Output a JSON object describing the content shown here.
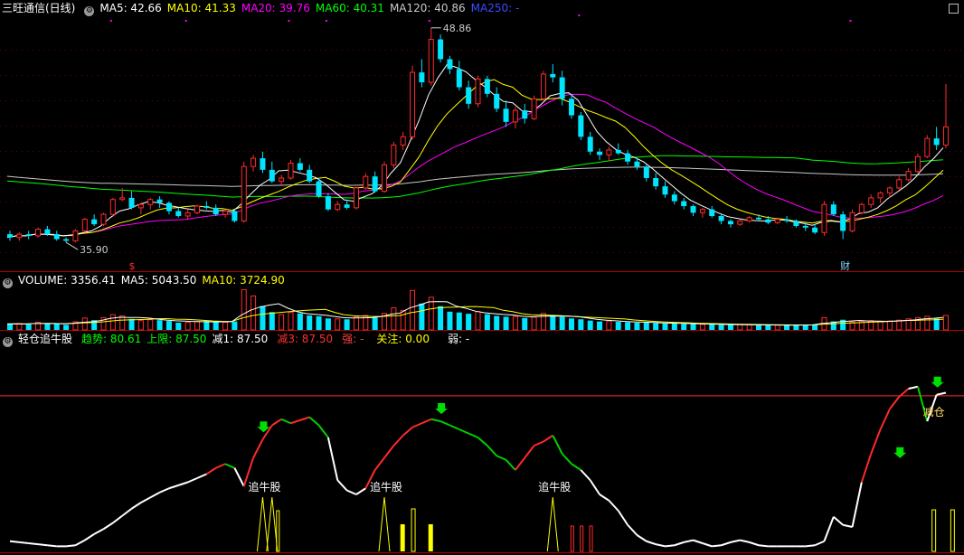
{
  "price_panel": {
    "stock_name": "三旺通信(日线)",
    "ma": [
      {
        "label": "MA5: 42.66",
        "color": "#ffffff"
      },
      {
        "label": "MA10: 41.33",
        "color": "#ffff00"
      },
      {
        "label": "MA20: 39.76",
        "color": "#ff00ff"
      },
      {
        "label": "MA60: 40.31",
        "color": "#00ff00"
      },
      {
        "label": "MA120: 40.86",
        "color": "#c8c8c8"
      },
      {
        "label": "MA250: -",
        "color": "#3a4cff"
      }
    ],
    "high_label": "48.86",
    "low_label": "35.90",
    "marker_dollar": "$",
    "marker_cai": "财"
  },
  "volume_panel": {
    "items": [
      {
        "label": "VOLUME: 3356.41",
        "color": "#ffffff"
      },
      {
        "label": "MA5: 5043.50",
        "color": "#ffffff"
      },
      {
        "label": "MA10: 3724.90",
        "color": "#ffff00"
      }
    ]
  },
  "indicator_panel": {
    "name": "轻仓追牛股",
    "items": [
      {
        "label": "趋势: 80.61",
        "color": "#00ff00"
      },
      {
        "label": "上限: 87.50",
        "color": "#00ff00"
      },
      {
        "label": "减1: 87.50",
        "color": "#ffffff"
      },
      {
        "label": "减3: 87.50",
        "color": "#ff3030"
      },
      {
        "label": "强: -",
        "color": "#ff4040"
      },
      {
        "label": "关注: 0.00",
        "color": "#ffff00"
      },
      {
        "label": "弱: -",
        "color": "#ffffff"
      }
    ],
    "zhuiniu_label": "追牛股",
    "jiancang_label": "减仓"
  },
  "chart_data": {
    "type": "candlestick",
    "title": "三旺通信(日线)",
    "ylim": [
      35.2,
      49.6
    ],
    "candles": [
      [
        36.4,
        36.6,
        36.0,
        36.2
      ],
      [
        36.2,
        36.5,
        36.0,
        36.4
      ],
      [
        36.4,
        36.6,
        36.1,
        36.3
      ],
      [
        36.3,
        36.8,
        36.2,
        36.7
      ],
      [
        36.7,
        36.9,
        36.3,
        36.4
      ],
      [
        36.4,
        36.6,
        36.0,
        36.1
      ],
      [
        36.1,
        36.2,
        35.9,
        36.0
      ],
      [
        36.0,
        36.7,
        35.9,
        36.6
      ],
      [
        36.6,
        37.4,
        36.5,
        37.3
      ],
      [
        37.3,
        37.6,
        36.9,
        37.0
      ],
      [
        37.0,
        37.7,
        36.9,
        37.6
      ],
      [
        37.6,
        38.6,
        37.5,
        38.5
      ],
      [
        38.5,
        39.2,
        38.4,
        38.6
      ],
      [
        38.6,
        39.0,
        37.9,
        38.0
      ],
      [
        38.0,
        38.3,
        37.6,
        38.2
      ],
      [
        38.2,
        38.6,
        37.9,
        38.5
      ],
      [
        38.5,
        38.7,
        38.0,
        38.3
      ],
      [
        38.3,
        38.4,
        37.6,
        37.8
      ],
      [
        37.8,
        38.0,
        37.4,
        37.5
      ],
      [
        37.5,
        37.9,
        37.3,
        37.7
      ],
      [
        37.7,
        38.2,
        37.6,
        38.1
      ],
      [
        38.1,
        38.4,
        37.9,
        38.0
      ],
      [
        38.0,
        38.2,
        37.5,
        37.6
      ],
      [
        37.6,
        37.9,
        37.4,
        37.8
      ],
      [
        37.8,
        37.9,
        37.1,
        37.2
      ],
      [
        37.2,
        40.8,
        37.1,
        40.5
      ],
      [
        40.5,
        41.2,
        40.2,
        41.0
      ],
      [
        41.0,
        41.4,
        40.1,
        40.3
      ],
      [
        40.3,
        40.8,
        39.5,
        39.6
      ],
      [
        39.6,
        40.0,
        39.3,
        39.8
      ],
      [
        39.8,
        40.9,
        39.7,
        40.7
      ],
      [
        40.7,
        41.0,
        40.2,
        40.3
      ],
      [
        40.3,
        40.6,
        39.5,
        39.6
      ],
      [
        39.6,
        39.8,
        38.6,
        38.7
      ],
      [
        38.7,
        38.9,
        37.8,
        37.9
      ],
      [
        37.9,
        38.4,
        37.8,
        38.2
      ],
      [
        38.2,
        38.5,
        37.9,
        38.0
      ],
      [
        38.0,
        39.3,
        37.9,
        39.2
      ],
      [
        39.2,
        40.1,
        39.1,
        39.9
      ],
      [
        39.9,
        40.2,
        38.9,
        39.0
      ],
      [
        39.0,
        40.8,
        38.9,
        40.6
      ],
      [
        40.6,
        42.0,
        40.4,
        41.8
      ],
      [
        41.8,
        42.6,
        41.5,
        42.3
      ],
      [
        42.3,
        46.6,
        42.1,
        46.2
      ],
      [
        46.2,
        47.0,
        45.3,
        45.6
      ],
      [
        45.6,
        48.9,
        45.4,
        48.2
      ],
      [
        48.2,
        48.5,
        46.8,
        47.0
      ],
      [
        47.0,
        47.2,
        46.1,
        46.4
      ],
      [
        46.4,
        46.9,
        45.1,
        45.3
      ],
      [
        45.3,
        45.7,
        44.0,
        44.3
      ],
      [
        44.3,
        46.0,
        44.1,
        45.8
      ],
      [
        45.8,
        46.0,
        44.7,
        44.9
      ],
      [
        44.9,
        45.3,
        43.8,
        44.0
      ],
      [
        44.0,
        44.5,
        42.9,
        43.2
      ],
      [
        43.2,
        44.1,
        42.8,
        43.9
      ],
      [
        43.9,
        44.3,
        43.1,
        43.4
      ],
      [
        43.4,
        44.8,
        43.3,
        44.6
      ],
      [
        44.6,
        46.3,
        44.5,
        46.1
      ],
      [
        46.1,
        46.7,
        45.6,
        45.9
      ],
      [
        45.9,
        46.3,
        44.2,
        44.6
      ],
      [
        44.6,
        44.9,
        43.4,
        43.6
      ],
      [
        43.6,
        43.8,
        42.1,
        42.3
      ],
      [
        42.3,
        42.6,
        41.2,
        41.4
      ],
      [
        41.4,
        41.6,
        40.9,
        41.2
      ],
      [
        41.2,
        41.7,
        40.8,
        41.5
      ],
      [
        41.5,
        41.9,
        41.2,
        41.3
      ],
      [
        41.3,
        41.5,
        40.6,
        40.8
      ],
      [
        40.8,
        41.0,
        40.3,
        40.5
      ],
      [
        40.5,
        40.6,
        39.6,
        39.8
      ],
      [
        39.8,
        40.1,
        39.1,
        39.3
      ],
      [
        39.3,
        39.6,
        38.6,
        38.8
      ],
      [
        38.8,
        39.0,
        38.2,
        38.4
      ],
      [
        38.4,
        38.6,
        37.9,
        38.1
      ],
      [
        38.1,
        38.2,
        37.5,
        37.7
      ],
      [
        37.7,
        38.0,
        37.4,
        37.9
      ],
      [
        37.9,
        38.1,
        37.4,
        37.5
      ],
      [
        37.5,
        37.6,
        37.0,
        37.2
      ],
      [
        37.2,
        37.3,
        36.8,
        37.0
      ],
      [
        37.0,
        37.3,
        36.9,
        37.2
      ],
      [
        37.2,
        37.5,
        37.1,
        37.4
      ],
      [
        37.4,
        37.6,
        37.2,
        37.3
      ],
      [
        37.3,
        37.5,
        37.0,
        37.1
      ],
      [
        37.1,
        37.4,
        37.0,
        37.3
      ],
      [
        37.3,
        37.5,
        37.1,
        37.2
      ],
      [
        37.2,
        37.3,
        36.8,
        36.9
      ],
      [
        36.9,
        37.1,
        36.6,
        36.8
      ],
      [
        36.8,
        37.0,
        36.4,
        36.5
      ],
      [
        36.5,
        38.4,
        36.3,
        38.2
      ],
      [
        38.2,
        38.4,
        37.5,
        37.6
      ],
      [
        37.6,
        37.8,
        36.1,
        36.6
      ],
      [
        36.6,
        37.9,
        36.5,
        37.7
      ],
      [
        37.7,
        38.3,
        37.6,
        38.2
      ],
      [
        38.2,
        38.8,
        38.0,
        38.6
      ],
      [
        38.6,
        39.0,
        38.3,
        38.9
      ],
      [
        38.9,
        39.3,
        38.6,
        39.2
      ],
      [
        39.2,
        39.9,
        39.1,
        39.7
      ],
      [
        39.7,
        40.4,
        39.6,
        40.2
      ],
      [
        40.2,
        41.3,
        40.1,
        41.1
      ],
      [
        41.1,
        42.4,
        41.0,
        42.2
      ],
      [
        42.2,
        42.9,
        41.5,
        41.8
      ],
      [
        41.8,
        45.5,
        41.6,
        42.9
      ]
    ],
    "volume_ylim": [
      0,
      10000
    ],
    "volume": [
      1400,
      1500,
      1300,
      1800,
      1600,
      1400,
      1200,
      1900,
      2800,
      2300,
      2900,
      3600,
      3300,
      2600,
      2200,
      2400,
      2300,
      2100,
      1700,
      1800,
      2000,
      2100,
      1900,
      1800,
      2000,
      9500,
      8000,
      5600,
      4200,
      3600,
      4100,
      3900,
      3400,
      3200,
      2700,
      2600,
      2500,
      3100,
      3400,
      2900,
      3900,
      5200,
      4600,
      9300,
      6200,
      7700,
      5600,
      4300,
      4100,
      3800,
      4300,
      3700,
      3300,
      3100,
      3200,
      2800,
      3000,
      3900,
      3500,
      3100,
      2700,
      2500,
      2200,
      2000,
      2100,
      1900,
      1800,
      1700,
      1700,
      1600,
      1500,
      1500,
      1400,
      1400,
      1300,
      1300,
      1200,
      1200,
      1300,
      1200,
      1100,
      1100,
      1100,
      1100,
      1200,
      1200,
      1200,
      2900,
      2000,
      2400,
      1900,
      2000,
      2200,
      1900,
      2100,
      2300,
      2600,
      2900,
      3200,
      2700,
      3400
    ],
    "indicator_ylim": [
      0,
      100
    ],
    "trend": [
      5,
      4.5,
      4,
      3.5,
      3,
      2.5,
      2.5,
      3,
      5.5,
      8.5,
      11,
      14,
      17.5,
      21,
      24,
      26.5,
      29,
      31,
      32.5,
      34,
      36,
      38,
      41,
      43,
      41,
      32,
      46,
      55,
      62,
      65,
      63,
      64.5,
      66,
      62,
      56,
      35,
      30,
      28,
      31,
      40,
      46,
      52,
      57,
      61,
      63,
      65,
      64,
      62,
      60,
      58,
      56,
      52,
      47,
      45,
      40,
      46,
      52,
      54,
      57,
      48,
      43,
      40,
      35,
      28,
      25,
      20,
      13,
      8,
      5,
      3.5,
      2.5,
      3,
      4.5,
      5.5,
      4,
      2.5,
      3,
      4.5,
      5.5,
      4.5,
      3,
      2.5,
      2.5,
      2.5,
      2.5,
      2.5,
      3,
      5,
      17,
      13,
      12,
      34,
      48,
      60,
      70,
      76,
      80,
      81,
      64,
      77,
      78
    ],
    "upper_line": 76.5,
    "zhuiniu_columns": [
      27,
      28,
      40,
      58
    ],
    "yellow_bars": [
      42,
      45
    ],
    "red_bars": [
      61,
      62,
      63
    ],
    "right_bars": [
      99,
      101
    ]
  }
}
